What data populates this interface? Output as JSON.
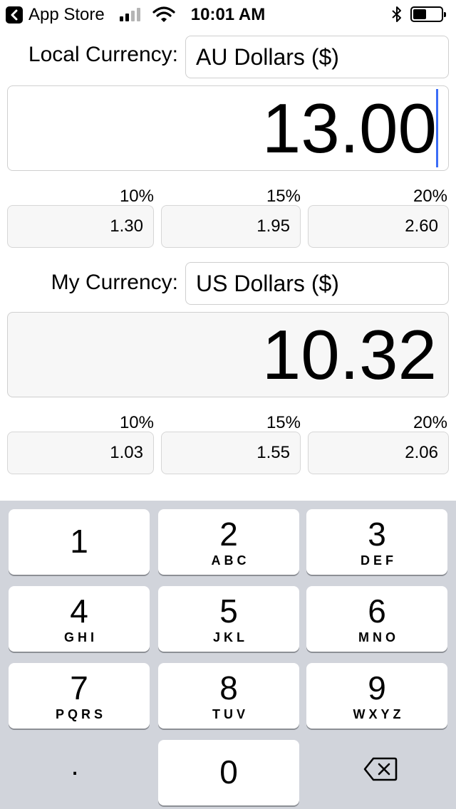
{
  "status_bar": {
    "back_label": "App Store",
    "time": "10:01 AM"
  },
  "local": {
    "label": "Local Currency:",
    "currency": "AU Dollars ($)",
    "amount": "13.00",
    "tips": [
      {
        "percent": "10%",
        "value": "1.30"
      },
      {
        "percent": "15%",
        "value": "1.95"
      },
      {
        "percent": "20%",
        "value": "2.60"
      }
    ]
  },
  "mine": {
    "label": "My Currency:",
    "currency": "US Dollars ($)",
    "amount": "10.32",
    "tips": [
      {
        "percent": "10%",
        "value": "1.03"
      },
      {
        "percent": "15%",
        "value": "1.55"
      },
      {
        "percent": "20%",
        "value": "2.06"
      }
    ]
  },
  "keypad": {
    "keys": [
      {
        "digit": "1",
        "letters": ""
      },
      {
        "digit": "2",
        "letters": "ABC"
      },
      {
        "digit": "3",
        "letters": "DEF"
      },
      {
        "digit": "4",
        "letters": "GHI"
      },
      {
        "digit": "5",
        "letters": "JKL"
      },
      {
        "digit": "6",
        "letters": "MNO"
      },
      {
        "digit": "7",
        "letters": "PQRS"
      },
      {
        "digit": "8",
        "letters": "TUV"
      },
      {
        "digit": "9",
        "letters": "WXYZ"
      },
      {
        "digit": "0",
        "letters": ""
      }
    ],
    "decimal": ".",
    "delete_icon": "backspace-icon"
  },
  "colors": {
    "cursor": "#3b6cf6",
    "keypad_bg": "#d1d4db"
  }
}
